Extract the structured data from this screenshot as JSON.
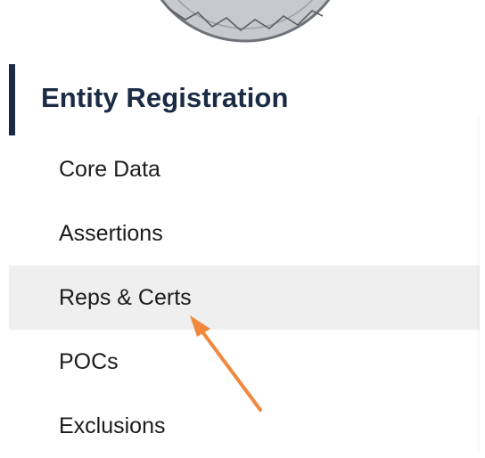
{
  "section": {
    "title": "Entity Registration"
  },
  "items": [
    {
      "label": "Core Data"
    },
    {
      "label": "Assertions"
    },
    {
      "label": "Reps & Certs",
      "highlighted": true
    },
    {
      "label": "POCs"
    },
    {
      "label": "Exclusions"
    }
  ],
  "colors": {
    "primary": "#1b2b45",
    "highlight_bg": "#efefef",
    "annotation": "#f0883e",
    "seal": "#8a8d93"
  },
  "icons": {
    "seal": "seal-icon",
    "annotation": "arrow-up-left-icon"
  }
}
